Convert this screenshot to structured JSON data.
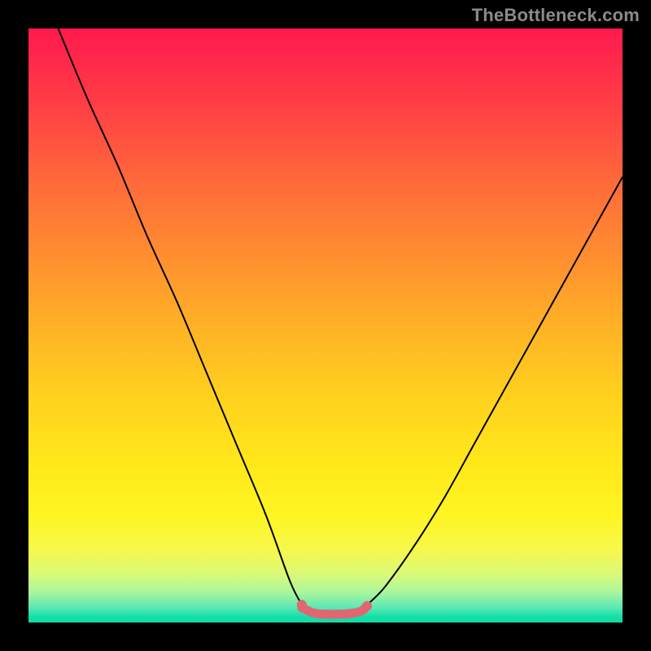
{
  "watermark": "TheBottleneck.com",
  "chart_data": {
    "type": "line",
    "title": "",
    "xlabel": "",
    "ylabel": "",
    "xlim": [
      0,
      100
    ],
    "ylim": [
      0,
      100
    ],
    "grid": false,
    "legend": false,
    "series": [
      {
        "name": "left-branch",
        "color": "#000000",
        "x": [
          5,
          10,
          15,
          20,
          25,
          30,
          35,
          40,
          44,
          46
        ],
        "y": [
          100,
          88,
          77,
          65,
          54,
          42,
          30,
          18,
          7,
          3
        ]
      },
      {
        "name": "right-branch",
        "color": "#000000",
        "x": [
          57,
          60,
          65,
          70,
          75,
          80,
          85,
          90,
          95,
          100
        ],
        "y": [
          3,
          6,
          13,
          21,
          30,
          39,
          48,
          57,
          66,
          75
        ]
      },
      {
        "name": "flat-segment",
        "color": "#e06672",
        "x": [
          46,
          48,
          50,
          52,
          54,
          56,
          57
        ],
        "y": [
          2.5,
          1.6,
          1.4,
          1.4,
          1.5,
          1.9,
          2.8
        ]
      }
    ],
    "markers": [
      {
        "name": "left-dot",
        "x": 46,
        "y": 3,
        "color": "#e06672"
      },
      {
        "name": "right-dot",
        "x": 57,
        "y": 2.8,
        "color": "#e06672"
      }
    ],
    "background_gradient_stops": [
      {
        "pos": 0,
        "color": "#ff1a4d"
      },
      {
        "pos": 0.5,
        "color": "#ffb126"
      },
      {
        "pos": 0.82,
        "color": "#fff522"
      },
      {
        "pos": 1.0,
        "color": "#10dca5"
      }
    ]
  }
}
